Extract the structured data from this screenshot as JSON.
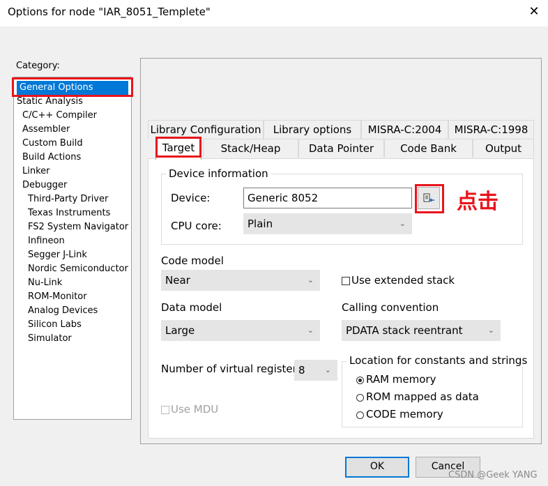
{
  "window": {
    "title": "Options for node \"IAR_8051_Templete\"",
    "close_glyph": "✕"
  },
  "category": {
    "label": "Category:",
    "items": [
      {
        "label": "General Options",
        "level": 0,
        "selected": true
      },
      {
        "label": "Static Analysis",
        "level": 0
      },
      {
        "label": "C/C++ Compiler",
        "level": 1
      },
      {
        "label": "Assembler",
        "level": 1
      },
      {
        "label": "Custom Build",
        "level": 1
      },
      {
        "label": "Build Actions",
        "level": 1
      },
      {
        "label": "Linker",
        "level": 1
      },
      {
        "label": "Debugger",
        "level": 1
      },
      {
        "label": "Third-Party Driver",
        "level": 2
      },
      {
        "label": "Texas Instruments",
        "level": 2
      },
      {
        "label": "FS2 System Navigator",
        "level": 2
      },
      {
        "label": "Infineon",
        "level": 2
      },
      {
        "label": "Segger J-Link",
        "level": 2
      },
      {
        "label": "Nordic Semiconductor",
        "level": 2
      },
      {
        "label": "Nu-Link",
        "level": 2
      },
      {
        "label": "ROM-Monitor",
        "level": 2
      },
      {
        "label": "Analog Devices",
        "level": 2
      },
      {
        "label": "Silicon Labs",
        "level": 2
      },
      {
        "label": "Simulator",
        "level": 2
      }
    ]
  },
  "tabs": {
    "row1": [
      "Library Configuration",
      "Library options",
      "MISRA-C:2004",
      "MISRA-C:1998"
    ],
    "row2": [
      "Target",
      "Stack/Heap",
      "Data Pointer",
      "Code Bank",
      "Output"
    ],
    "active": "Target"
  },
  "device_info": {
    "group_title": "Device information",
    "device_label": "Device:",
    "device_value": "Generic 8052",
    "cpu_core_label": "CPU core:",
    "cpu_core_value": "Plain"
  },
  "code_model": {
    "label": "Code model",
    "value": "Near"
  },
  "extended_stack": {
    "label": "Use extended stack",
    "checked": false
  },
  "data_model": {
    "label": "Data model",
    "value": "Large"
  },
  "calling_convention": {
    "label": "Calling convention",
    "value": "PDATA stack reentrant"
  },
  "virtual_registers": {
    "label": "Number of virtual registers:",
    "value": "8"
  },
  "use_mdu": {
    "label": "Use MDU",
    "checked": false,
    "enabled": false
  },
  "location": {
    "group_title": "Location for constants and strings",
    "options": [
      "RAM memory",
      "ROM mapped as data",
      "CODE memory"
    ],
    "selected": "RAM memory"
  },
  "buttons": {
    "ok": "OK",
    "cancel": "Cancel"
  },
  "annotation": {
    "text": "点击",
    "color": "#e8141c"
  },
  "watermark": "CSDN @Geek YANG"
}
